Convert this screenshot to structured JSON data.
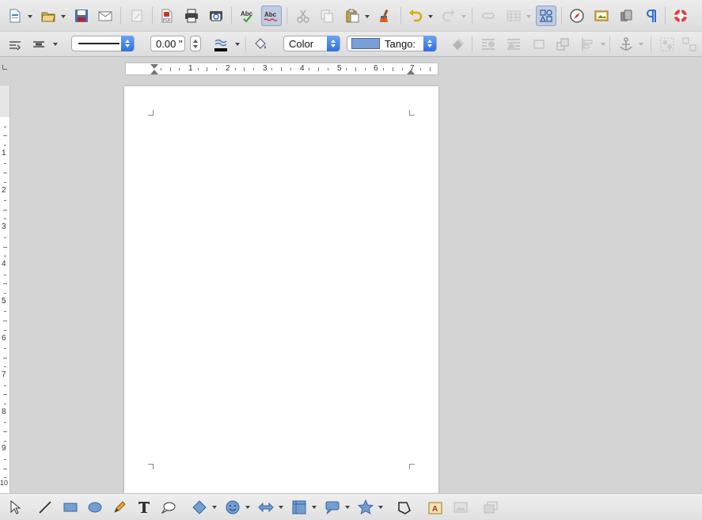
{
  "frame_toolbar": {
    "line_width_value": "0.00 \"",
    "area_style_value": "Color",
    "area_fill_value": "Tango:"
  },
  "ruler": {
    "horizontal_numbers": [
      "1",
      "2",
      "3",
      "4",
      "5",
      "6",
      "7"
    ],
    "vertical_numbers": [
      "1",
      "2",
      "3",
      "4",
      "5",
      "6",
      "7",
      "8",
      "9",
      "10"
    ]
  },
  "colors": {
    "toolbar_bg": "#e4e4e4",
    "active_button": "#bfcbe0",
    "spin_blue": "#3d7ff0",
    "fill_swatch": "#7a9fd6",
    "workspace_bg": "#d4d4d4"
  }
}
